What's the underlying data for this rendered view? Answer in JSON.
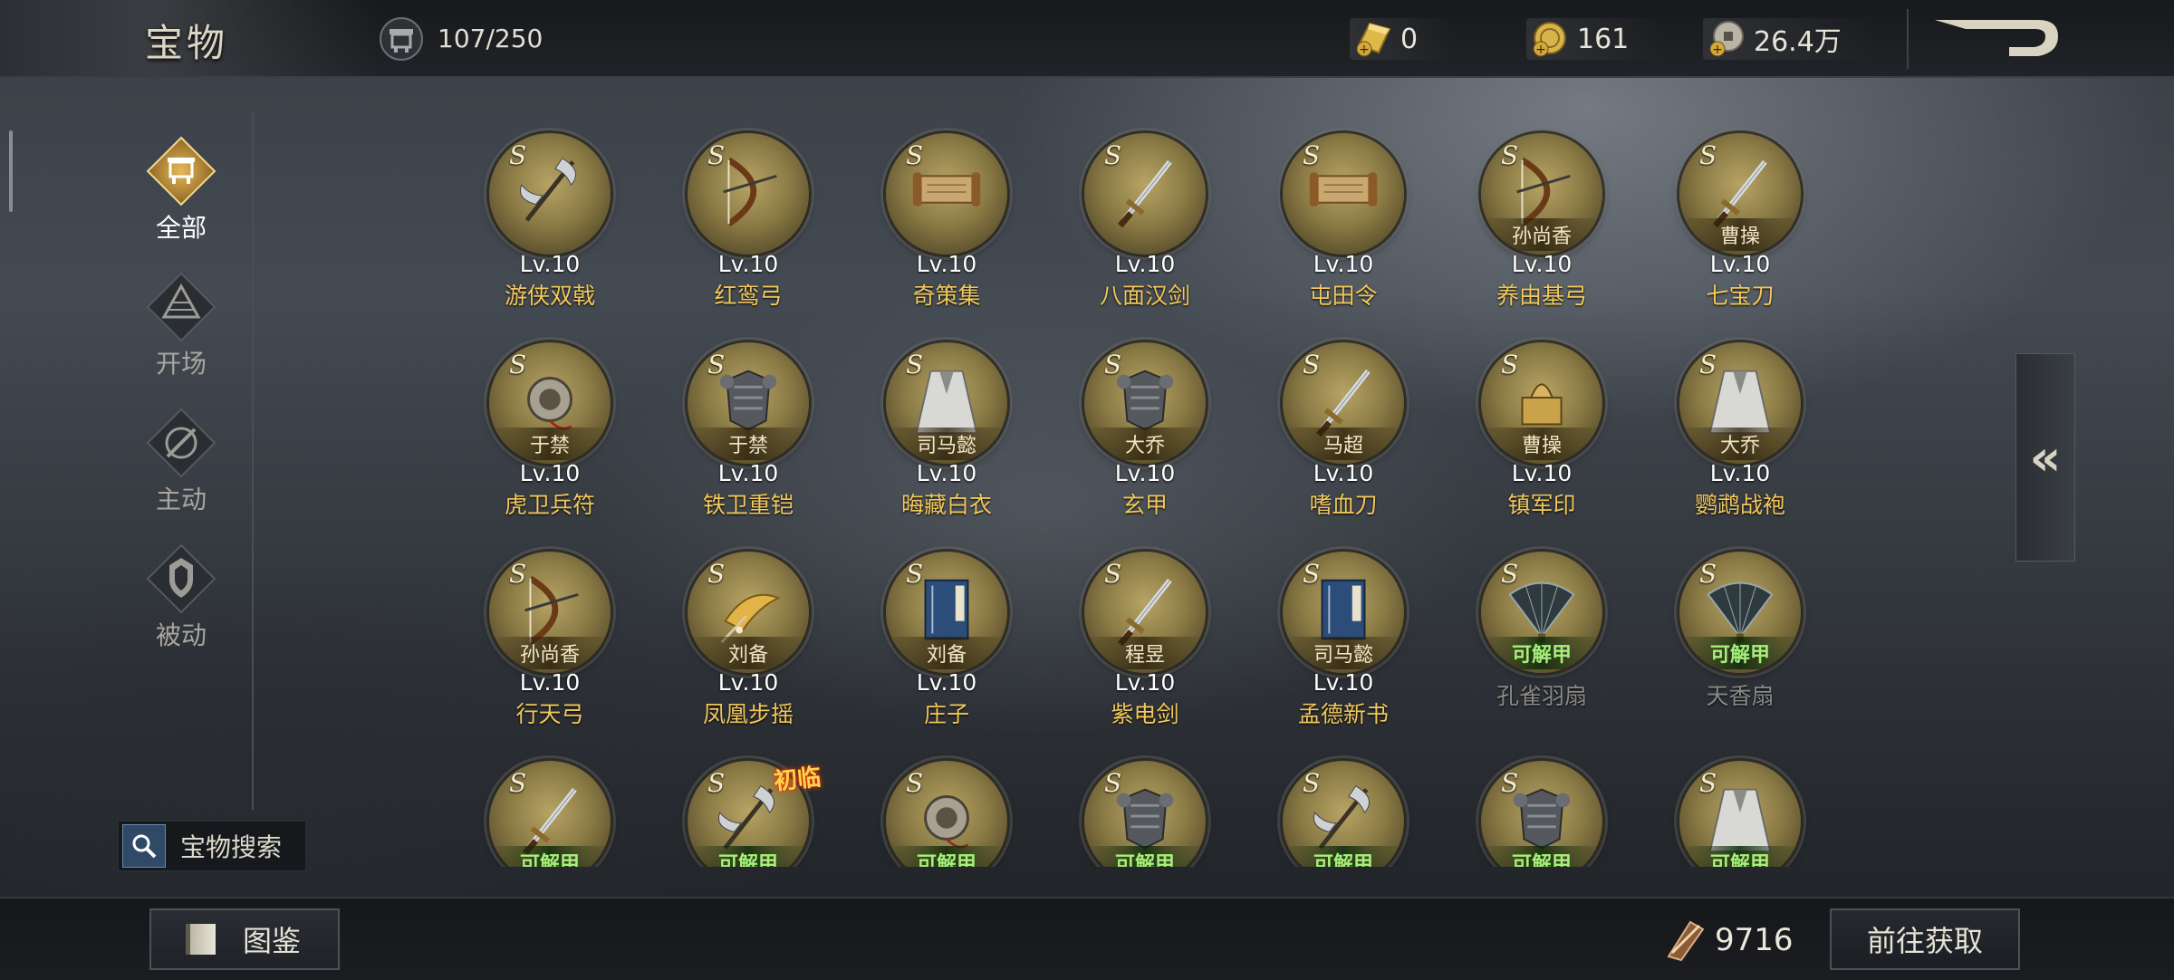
{
  "header": {
    "title": "宝物",
    "capacity": "107/250",
    "currencies": [
      {
        "icon": "gold-ingot-icon",
        "value": "0"
      },
      {
        "icon": "gold-coin-icon",
        "value": "161"
      },
      {
        "icon": "copper-coin-icon",
        "value": "26.4万"
      }
    ]
  },
  "nav": {
    "items": [
      {
        "label": "全部",
        "icon": "all-treasure-icon",
        "active": true
      },
      {
        "label": "开场",
        "icon": "opening-icon",
        "active": false
      },
      {
        "label": "主动",
        "icon": "active-skill-icon",
        "active": false
      },
      {
        "label": "被动",
        "icon": "passive-skill-icon",
        "active": false
      }
    ],
    "search_label": "宝物搜索"
  },
  "treasures": [
    {
      "grade": "S",
      "level": "Lv.10",
      "name": "游侠双戟",
      "owner": "",
      "art": "halberd"
    },
    {
      "grade": "S",
      "level": "Lv.10",
      "name": "红鸾弓",
      "owner": "",
      "art": "bow"
    },
    {
      "grade": "S",
      "level": "Lv.10",
      "name": "奇策集",
      "owner": "",
      "art": "scroll"
    },
    {
      "grade": "S",
      "level": "Lv.10",
      "name": "八面汉剑",
      "owner": "",
      "art": "sword"
    },
    {
      "grade": "S",
      "level": "Lv.10",
      "name": "屯田令",
      "owner": "",
      "art": "scroll"
    },
    {
      "grade": "S",
      "level": "Lv.10",
      "name": "养由基弓",
      "owner": "孙尚香",
      "art": "bow"
    },
    {
      "grade": "S",
      "level": "Lv.10",
      "name": "七宝刀",
      "owner": "曹操",
      "art": "sword"
    },
    {
      "grade": "S",
      "level": "Lv.10",
      "name": "虎卫兵符",
      "owner": "于禁",
      "art": "token"
    },
    {
      "grade": "S",
      "level": "Lv.10",
      "name": "铁卫重铠",
      "owner": "于禁",
      "art": "armor"
    },
    {
      "grade": "S",
      "level": "Lv.10",
      "name": "晦藏白衣",
      "owner": "司马懿",
      "art": "robe"
    },
    {
      "grade": "S",
      "level": "Lv.10",
      "name": "玄甲",
      "owner": "大乔",
      "art": "armor"
    },
    {
      "grade": "S",
      "level": "Lv.10",
      "name": "嗜血刀",
      "owner": "马超",
      "art": "sword"
    },
    {
      "grade": "S",
      "level": "Lv.10",
      "name": "镇军印",
      "owner": "曹操",
      "art": "seal"
    },
    {
      "grade": "S",
      "level": "Lv.10",
      "name": "鹦鹉战袍",
      "owner": "大乔",
      "art": "robe"
    },
    {
      "grade": "S",
      "level": "Lv.10",
      "name": "行天弓",
      "owner": "孙尚香",
      "art": "bow"
    },
    {
      "grade": "S",
      "level": "Lv.10",
      "name": "凤凰步摇",
      "owner": "刘备",
      "art": "hairpin"
    },
    {
      "grade": "S",
      "level": "Lv.10",
      "name": "庄子",
      "owner": "刘备",
      "art": "book"
    },
    {
      "grade": "S",
      "level": "Lv.10",
      "name": "紫电剑",
      "owner": "程昱",
      "art": "sword"
    },
    {
      "grade": "S",
      "level": "Lv.10",
      "name": "孟德新书",
      "owner": "司马懿",
      "art": "book"
    },
    {
      "grade": "S",
      "level": "",
      "name": "孔雀羽扇",
      "owner": "",
      "status": "可解甲",
      "art": "fan"
    },
    {
      "grade": "S",
      "level": "",
      "name": "天香扇",
      "owner": "",
      "status": "可解甲",
      "art": "fan"
    },
    {
      "grade": "S",
      "level": "",
      "name": "",
      "owner": "",
      "status": "可解甲",
      "art": "sword"
    },
    {
      "grade": "S",
      "level": "",
      "name": "",
      "owner": "",
      "status": "可解甲",
      "art": "halberd",
      "badge": "初临"
    },
    {
      "grade": "S",
      "level": "",
      "name": "",
      "owner": "",
      "status": "可解甲",
      "art": "token"
    },
    {
      "grade": "S",
      "level": "",
      "name": "",
      "owner": "",
      "status": "可解甲",
      "art": "armor"
    },
    {
      "grade": "S",
      "level": "",
      "name": "",
      "owner": "",
      "status": "可解甲",
      "art": "halberd"
    },
    {
      "grade": "S",
      "level": "",
      "name": "",
      "owner": "",
      "status": "可解甲",
      "art": "armor"
    },
    {
      "grade": "S",
      "level": "",
      "name": "",
      "owner": "",
      "status": "可解甲",
      "art": "robe"
    }
  ],
  "collapse_glyph": "«",
  "footer": {
    "atlas_label": "图鉴",
    "shard_count": "9716",
    "go_label": "前往获取"
  },
  "colors": {
    "name_gold": "#f2c85a",
    "dismantle_green": "#a6f07a",
    "medal_gold": "#8a7a45"
  }
}
